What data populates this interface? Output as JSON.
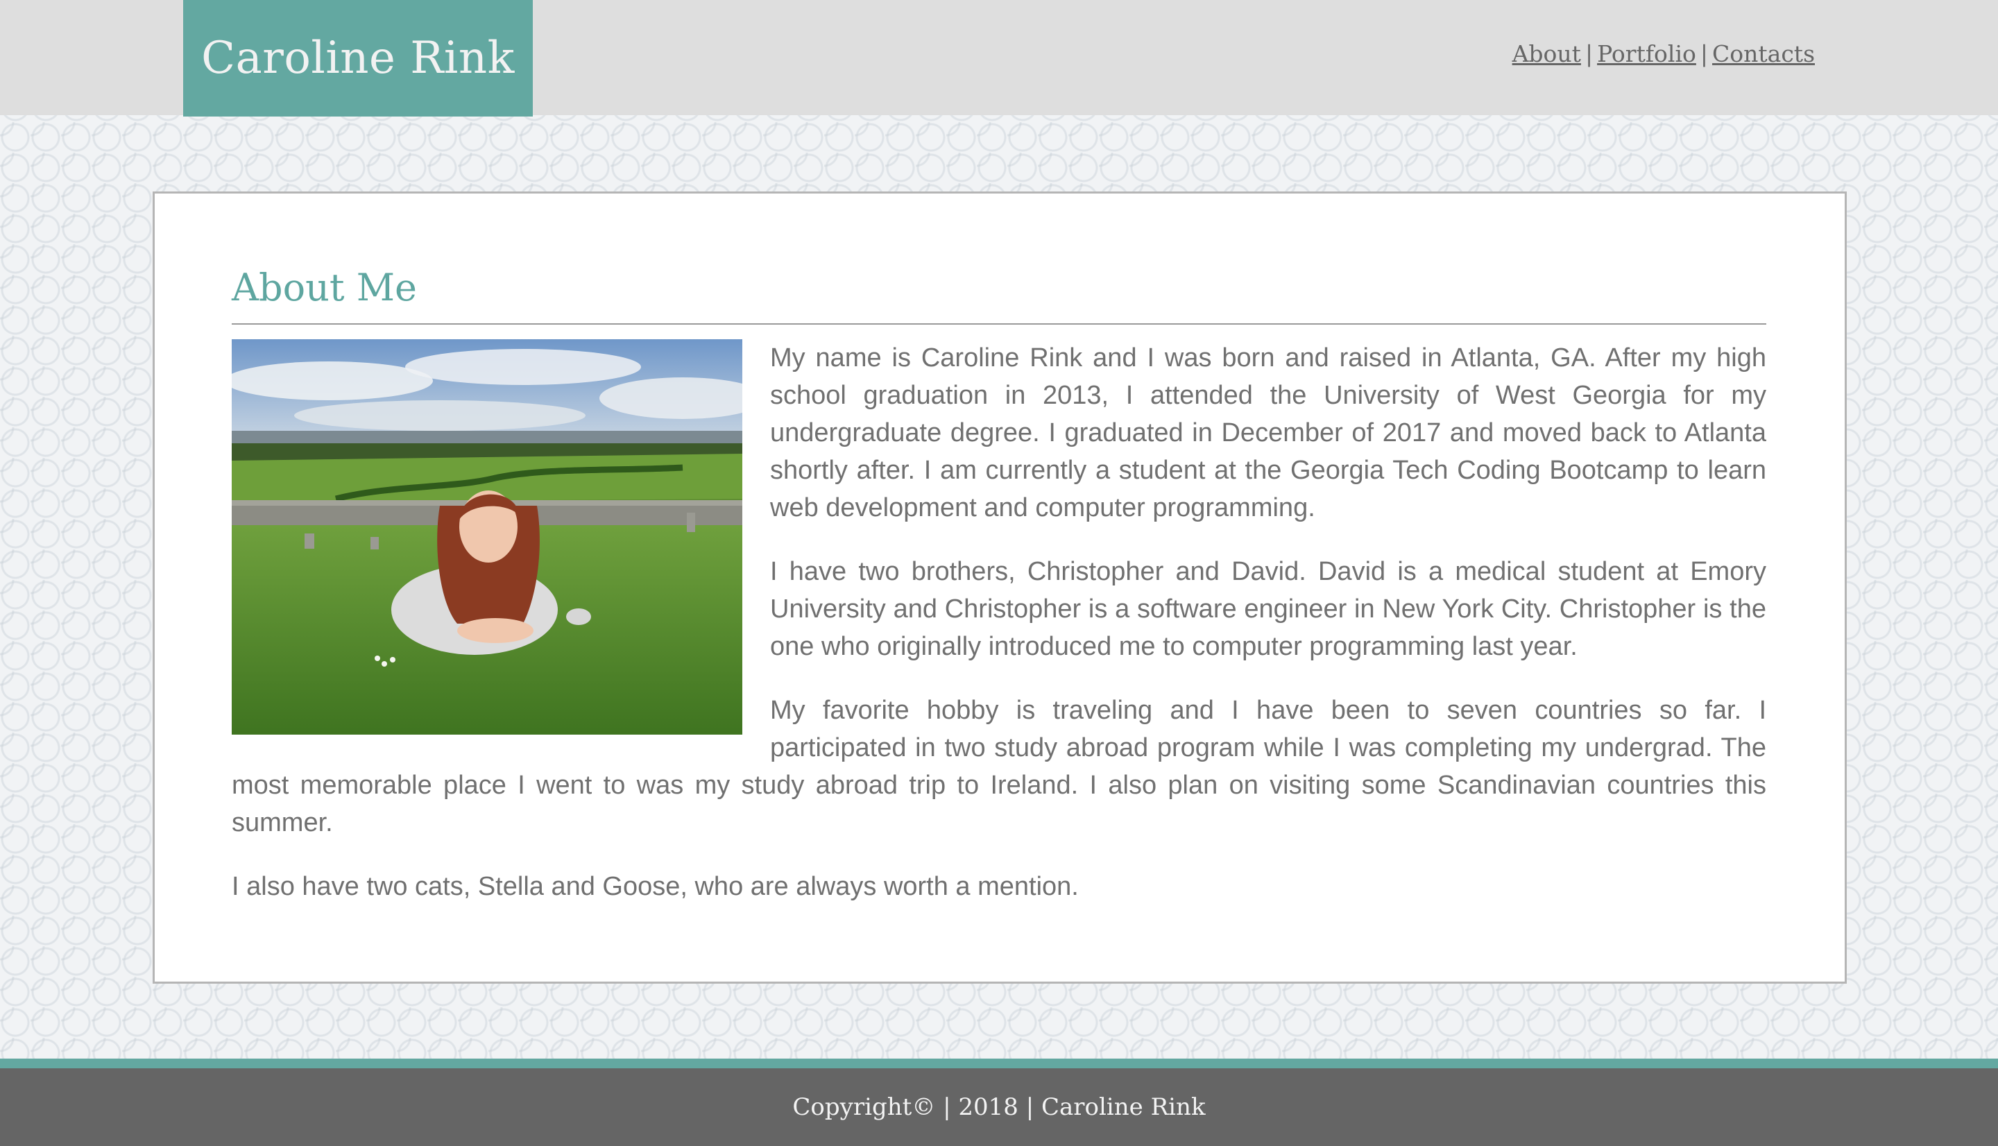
{
  "header": {
    "brand": "Caroline Rink",
    "nav": [
      {
        "label": "About"
      },
      {
        "label": "Portfolio"
      },
      {
        "label": "Contacts"
      }
    ],
    "separator": "|"
  },
  "about": {
    "title": "About Me",
    "photo_icon": "portrait-photo-in-green-field",
    "paragraphs": [
      "My name is Caroline Rink and I was born and raised in Atlanta, GA. After my high school graduation in 2013, I attended the University of West Georgia for my undergraduate degree. I graduated in December of 2017 and moved back to Atlanta shortly after. I am currently a student at the Georgia Tech Coding Bootcamp to learn web development and computer programming.",
      "I have two brothers, Christopher and David. David is a medical student at Emory University and Christopher is a software engineer in New York City. Christopher is the one who originally introduced me to computer programming last year.",
      "My favorite hobby is traveling and I have been to seven countries so far. I participated in two study abroad program while I was completing my undergrad. The most memorable place I went to was my study abroad trip to Ireland. I also plan on visiting some Scandinavian countries this summer.",
      "I also have two cats, Stella and Goose, who are always worth a mention."
    ]
  },
  "footer": {
    "text": "Copyright© | 2018 | Caroline Rink"
  },
  "colors": {
    "accent": "#63a8a1",
    "header_bg": "#dedede",
    "footer_bg": "#656565",
    "body_text": "#707070"
  }
}
